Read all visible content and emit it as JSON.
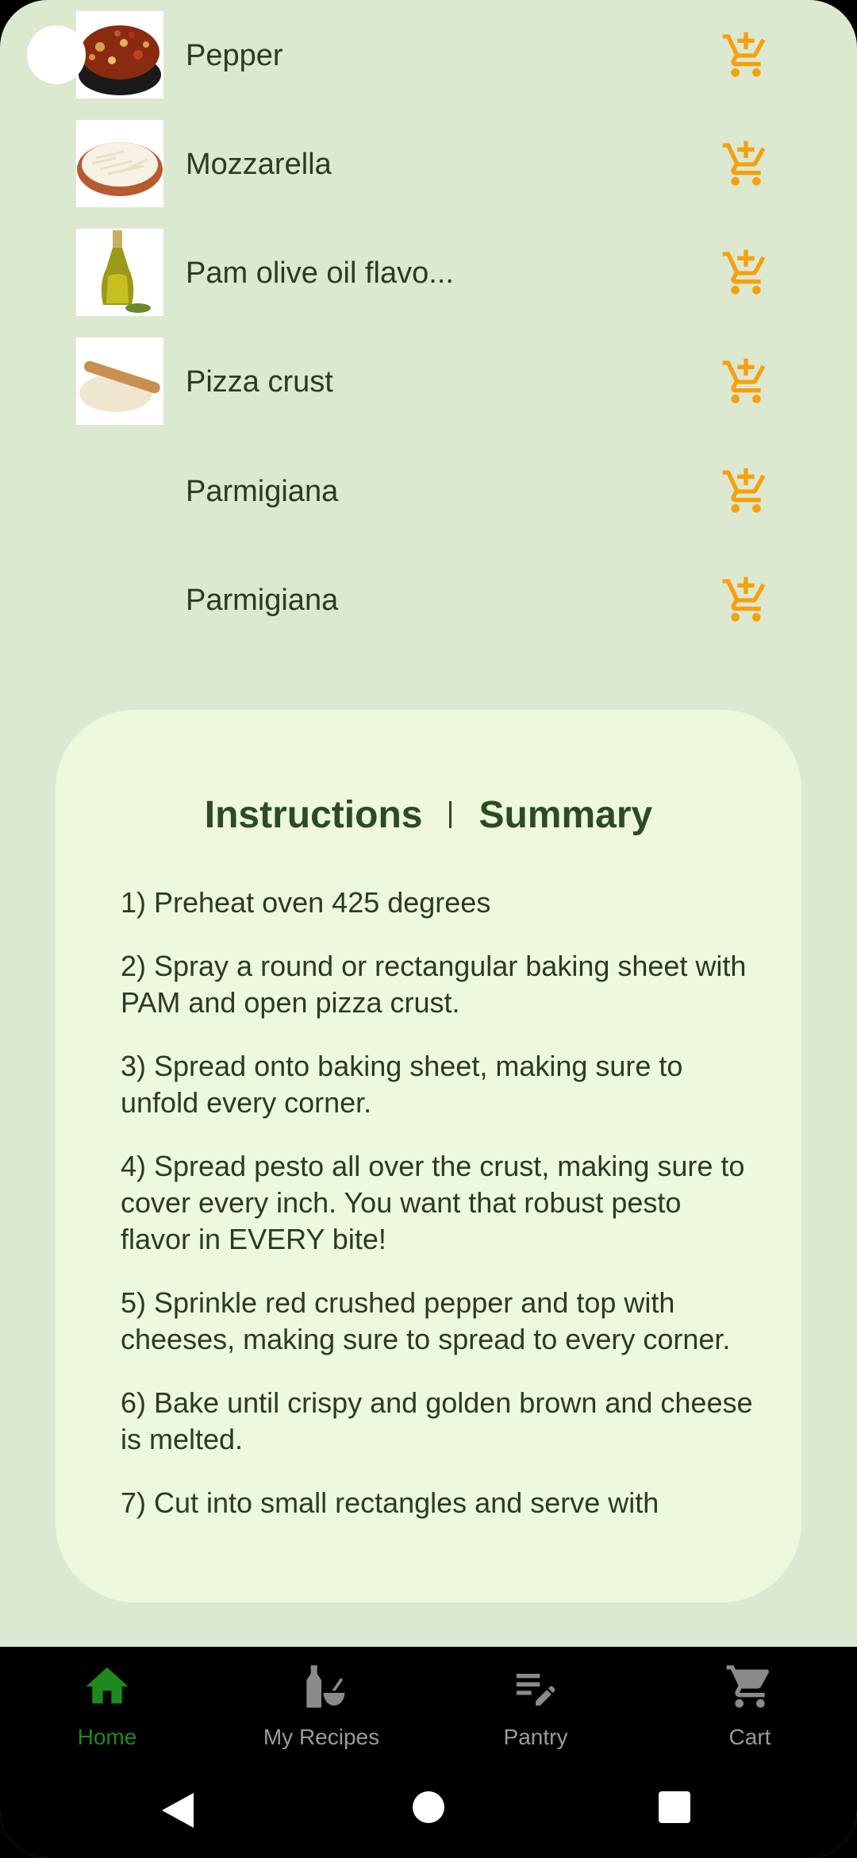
{
  "ingredients": [
    {
      "name": "Pepper",
      "has_image": true,
      "image": "pepper-flakes-image"
    },
    {
      "name": "Mozzarella",
      "has_image": true,
      "image": "mozzarella-image"
    },
    {
      "name": "Pam olive oil flavo...",
      "has_image": true,
      "image": "olive-oil-image"
    },
    {
      "name": "Pizza crust",
      "has_image": true,
      "image": "pizza-dough-image"
    },
    {
      "name": "Parmigiana",
      "has_image": false
    },
    {
      "name": "Parmigiana",
      "has_image": false
    }
  ],
  "colors": {
    "background": "#dde8d0",
    "card": "#eef8dc",
    "accent_orange": "#f5a10d",
    "active_green": "#1e8a1e",
    "text_dark": "#2b3a22"
  },
  "card": {
    "tabs": {
      "instructions": "Instructions",
      "summary": "Summary"
    },
    "steps": [
      "1) Preheat oven 425 degrees",
      "2) Spray a round or rectangular baking sheet with PAM and open pizza crust.",
      "3) Spread onto baking sheet, making sure to unfold every corner.",
      "4) Spread pesto all over the crust, making sure to cover every inch. You want that robust pesto flavor in EVERY bite!",
      "5) Sprinkle red crushed pepper and top with cheeses, making sure to spread to every corner.",
      "6) Bake until crispy and golden brown and cheese is melted.",
      "7) Cut into small rectangles and serve with"
    ]
  },
  "bottom_nav": {
    "items": [
      {
        "label": "Home",
        "icon": "home-icon",
        "active": true
      },
      {
        "label": "My Recipes",
        "icon": "bottle-bowl-icon",
        "active": false
      },
      {
        "label": "Pantry",
        "icon": "list-edit-icon",
        "active": false
      },
      {
        "label": "Cart",
        "icon": "cart-icon",
        "active": false
      }
    ]
  },
  "system_nav": {
    "back": "back-icon",
    "home": "home-circle-icon",
    "recents": "recents-icon"
  }
}
